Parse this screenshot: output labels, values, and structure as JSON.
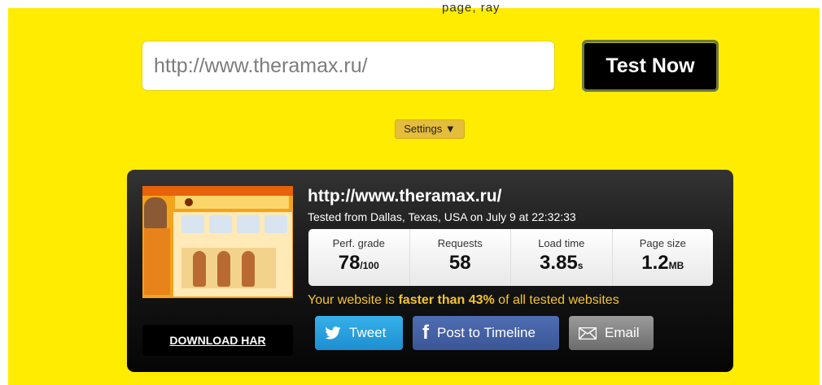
{
  "top_cut_text": "page, ray",
  "url_input": {
    "value": "http://www.theramax.ru/"
  },
  "test_button": {
    "label": "Test Now"
  },
  "settings": {
    "label": "Settings ▼"
  },
  "result": {
    "url": "http://www.theramax.ru/",
    "tested_from": "Tested from Dallas, Texas, USA on July 9 at 22:32:33",
    "stats": [
      {
        "label": "Perf. grade",
        "value": "78",
        "unit": "/100"
      },
      {
        "label": "Requests",
        "value": "58",
        "unit": ""
      },
      {
        "label": "Load time",
        "value": "3.85",
        "unit": "s"
      },
      {
        "label": "Page size",
        "value": "1.2",
        "unit": "MB"
      }
    ],
    "comparison": {
      "prefix": "Your website is ",
      "emphasis": "faster than 43%",
      "suffix": " of all tested websites"
    },
    "download_label": "DOWNLOAD HAR",
    "share": {
      "tweet": "Tweet",
      "facebook": "Post to Timeline",
      "email": "Email"
    }
  },
  "colors": {
    "background": "#ffec00",
    "card": "#1a1a1a",
    "accent": "#f6c52b",
    "tweet": "#1d8fd0",
    "facebook": "#3a5697",
    "email": "#6c6c6c"
  }
}
